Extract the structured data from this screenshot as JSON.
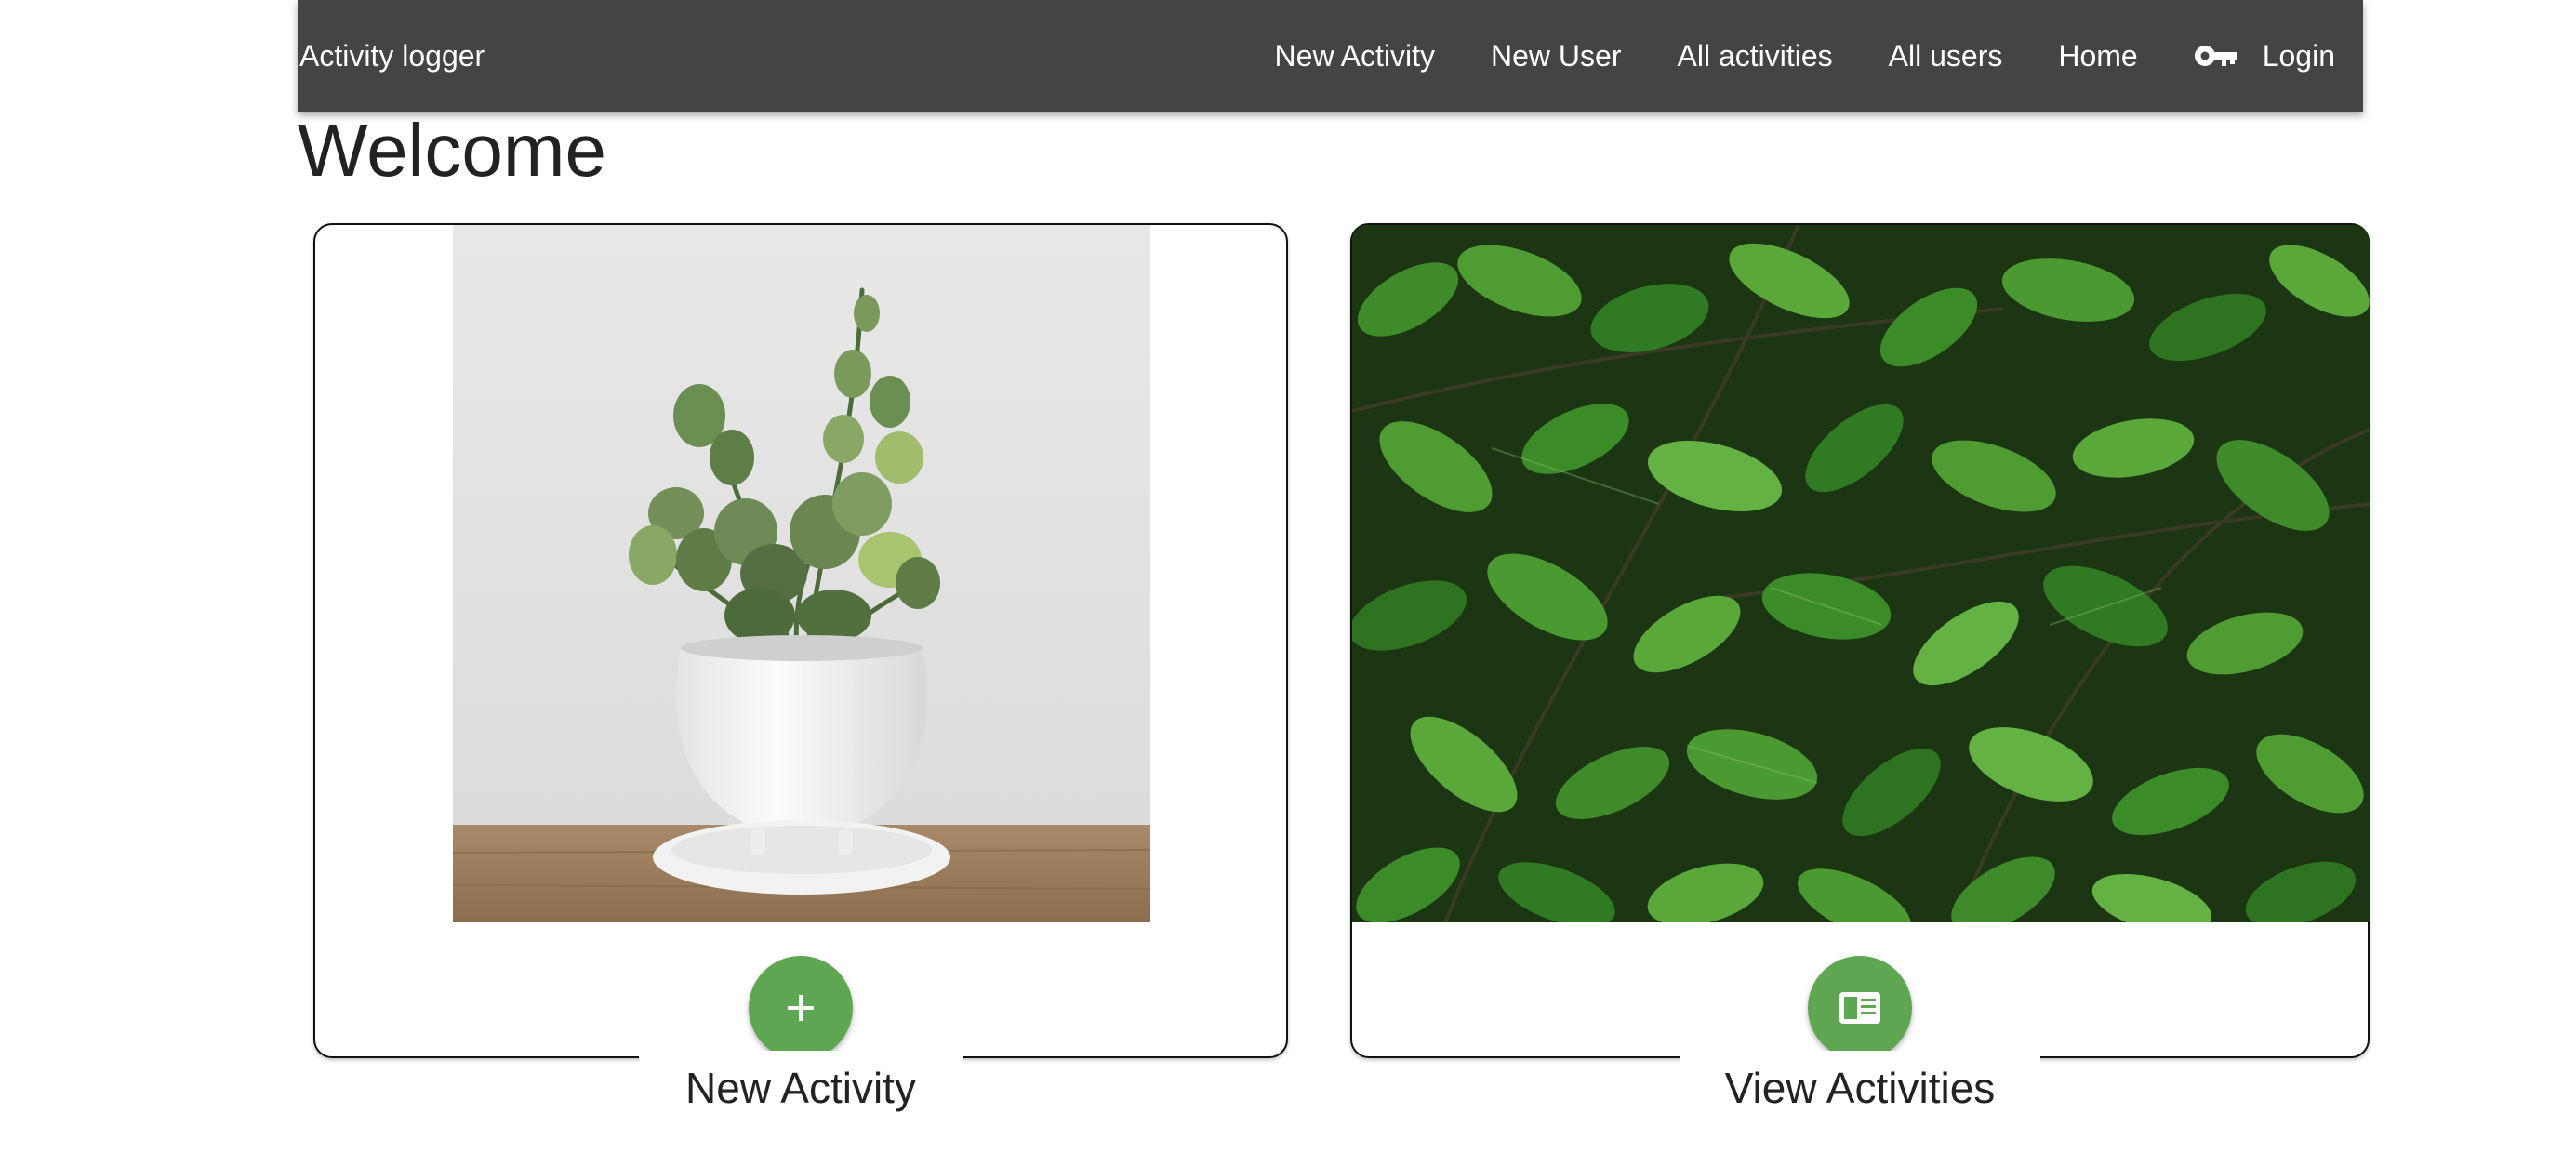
{
  "navbar": {
    "brand": "Activity logger",
    "links": [
      "New Activity",
      "New User",
      "All activities",
      "All users",
      "Home"
    ],
    "login_label": "Login",
    "login_icon": "key-icon",
    "background": "#444444"
  },
  "page": {
    "title": "Welcome"
  },
  "cards": [
    {
      "image": "potted-plant-image",
      "button_icon": "plus-icon",
      "label": "New Activity"
    },
    {
      "image": "green-leaves-image",
      "button_icon": "list-icon",
      "label": "View Activities"
    }
  ],
  "colors": {
    "accent": "#5ea651",
    "nav_text": "#ffffff",
    "text": "#222222"
  }
}
